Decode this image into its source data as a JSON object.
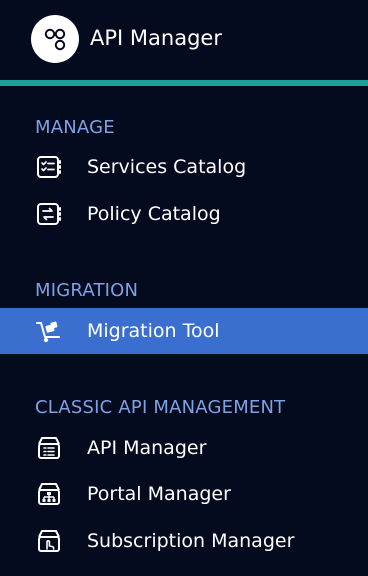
{
  "header": {
    "title": "API Manager",
    "logo_icon": "api-manager-logo-icon"
  },
  "colors": {
    "background": "#040b1e",
    "accent": "#1ba39a",
    "section_heading": "#7fa2e4",
    "active_item": "#3a6fd0",
    "text": "#ffffff"
  },
  "sections": {
    "manage": {
      "heading": "MANAGE",
      "items": [
        {
          "label": "Services Catalog",
          "icon": "services-catalog-icon"
        },
        {
          "label": "Policy Catalog",
          "icon": "policy-catalog-icon"
        }
      ]
    },
    "migration": {
      "heading": "MIGRATION",
      "items": [
        {
          "label": "Migration Tool",
          "icon": "migration-tool-icon",
          "active": true
        }
      ]
    },
    "classic": {
      "heading": "CLASSIC API MANAGEMENT",
      "items": [
        {
          "label": "API Manager",
          "icon": "api-manager-icon"
        },
        {
          "label": "Portal Manager",
          "icon": "portal-manager-icon"
        },
        {
          "label": "Subscription Manager",
          "icon": "subscription-manager-icon"
        }
      ]
    }
  }
}
